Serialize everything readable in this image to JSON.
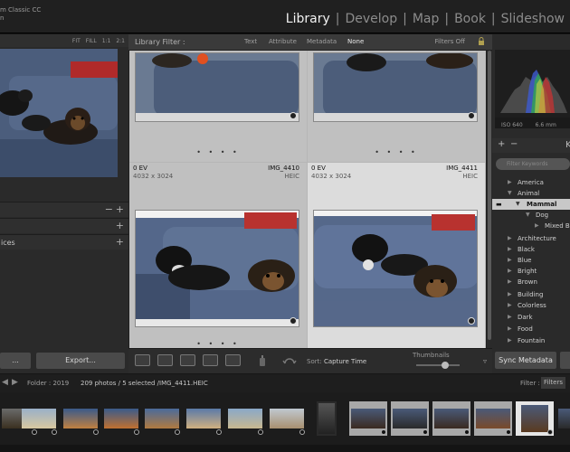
{
  "app": {
    "title_line1": "m Classic CC",
    "title_line2": "n"
  },
  "modules": [
    {
      "label": "Library",
      "active": true
    },
    {
      "label": "Develop",
      "active": false
    },
    {
      "label": "Map",
      "active": false
    },
    {
      "label": "Book",
      "active": false
    },
    {
      "label": "Slideshow",
      "active": false
    }
  ],
  "navigator": {
    "zooms": [
      "FIT",
      "FILL",
      "1:1",
      "2:1"
    ]
  },
  "left_panel": {
    "rows": [
      {
        "label": "",
        "minus": "−",
        "plus": "+"
      },
      {
        "label": "",
        "plus": "+"
      },
      {
        "label": "ices",
        "plus": "+"
      }
    ],
    "import_label": "...",
    "export_label": "Export..."
  },
  "filter_bar": {
    "title": "Library Filter :",
    "tabs": [
      "Text",
      "Attribute",
      "Metadata",
      "None"
    ],
    "active_tab": "None",
    "filters_off": "Filters Off"
  },
  "grid": {
    "cells": [
      {
        "ev": "0 EV",
        "dims": "4032 x 3024",
        "name": "IMG_4410",
        "format": "HEIC"
      },
      {
        "ev": "0 EV",
        "dims": "4032 x 3024",
        "name": "IMG_4411",
        "format": "HEIC"
      }
    ],
    "dots": "• • • •"
  },
  "toolbar": {
    "sort_label": "Sort:",
    "sort_value": "Capture Time",
    "thumbnails_label": "Thumbnails",
    "thumbnails_level": 0.7
  },
  "histogram": {
    "iso": "ISO 640",
    "focal": "6.6 mm",
    "box_label": "5"
  },
  "keywords": {
    "header_minus": "−",
    "header_plus": "+",
    "header_label": "K",
    "search_placeholder": "Filter Keywords",
    "items": [
      {
        "label": "America",
        "indent": 0,
        "expanded": false
      },
      {
        "label": "Animal",
        "indent": 0,
        "expanded": true
      },
      {
        "label": "Mammal",
        "indent": 1,
        "expanded": true,
        "highlight": true
      },
      {
        "label": "Dog",
        "indent": 2,
        "expanded": true
      },
      {
        "label": "Mixed Br",
        "indent": 3,
        "expanded": false
      },
      {
        "label": "Architecture",
        "indent": 0,
        "expanded": false
      },
      {
        "label": "Black",
        "indent": 0,
        "expanded": false
      },
      {
        "label": "Blue",
        "indent": 0,
        "expanded": false
      },
      {
        "label": "Bright",
        "indent": 0,
        "expanded": false
      },
      {
        "label": "Brown",
        "indent": 0,
        "expanded": false
      },
      {
        "label": "Building",
        "indent": 0,
        "expanded": false
      },
      {
        "label": "Colorless",
        "indent": 0,
        "expanded": false
      },
      {
        "label": "Dark",
        "indent": 0,
        "expanded": false
      },
      {
        "label": "Food",
        "indent": 0,
        "expanded": false
      },
      {
        "label": "Fountain",
        "indent": 0,
        "expanded": false
      }
    ]
  },
  "sync_label": "Sync Metadata",
  "filmstrip": {
    "folder": "Folder : 2019",
    "count": "209 photos / 5 selected /IMG_4411.HEIC",
    "filter_label": "Filter :",
    "filters_btn": "Filters"
  }
}
